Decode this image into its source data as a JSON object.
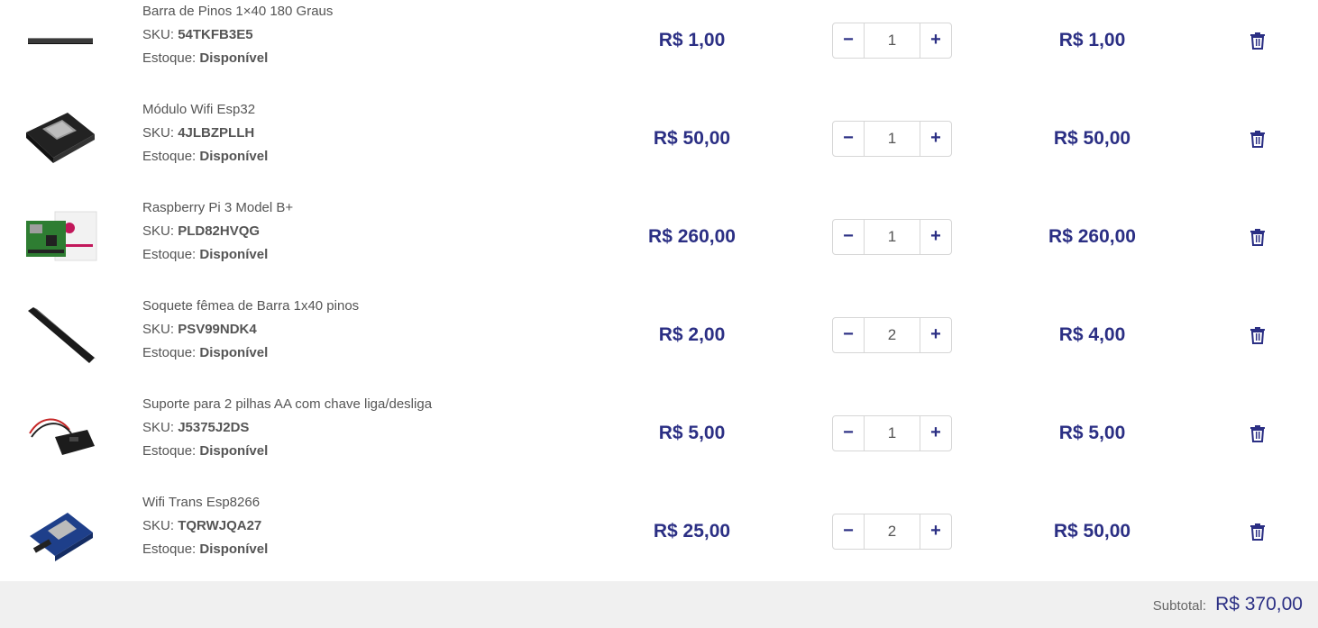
{
  "currency_prefix": "R$",
  "labels": {
    "sku": "SKU:",
    "stock": "Estoque:",
    "subtotal": "Subtotal:"
  },
  "items": [
    {
      "name": "Barra de Pinos 1×40 180 Graus",
      "sku": "54TKFB3E5",
      "stock": "Disponível",
      "price": "R$ 1,00",
      "quantity": "1",
      "total": "R$ 1,00",
      "decrease": "−",
      "increase": "+"
    },
    {
      "name": "Módulo Wifi Esp32",
      "sku": "4JLBZPLLH",
      "stock": "Disponível",
      "price": "R$ 50,00",
      "quantity": "1",
      "total": "R$ 50,00",
      "decrease": "−",
      "increase": "+"
    },
    {
      "name": "Raspberry Pi 3 Model B+",
      "sku": "PLD82HVQG",
      "stock": "Disponível",
      "price": "R$ 260,00",
      "quantity": "1",
      "total": "R$ 260,00",
      "decrease": "−",
      "increase": "+"
    },
    {
      "name": "Soquete fêmea de Barra 1x40 pinos",
      "sku": "PSV99NDK4",
      "stock": "Disponível",
      "price": "R$ 2,00",
      "quantity": "2",
      "total": "R$ 4,00",
      "decrease": "−",
      "increase": "+"
    },
    {
      "name": "Suporte para 2 pilhas AA com chave liga/desliga",
      "sku": "J5375J2DS",
      "stock": "Disponível",
      "price": "R$ 5,00",
      "quantity": "1",
      "total": "R$ 5,00",
      "decrease": "−",
      "increase": "+"
    },
    {
      "name": "Wifi Trans Esp8266",
      "sku": "TQRWJQA27",
      "stock": "Disponível",
      "price": "R$ 25,00",
      "quantity": "2",
      "total": "R$ 50,00",
      "decrease": "−",
      "increase": "+"
    }
  ],
  "subtotal": "R$ 370,00",
  "colors": {
    "accent": "#2b2f84",
    "footer_bg": "#f0f0f0",
    "text": "#555555"
  },
  "icons": {
    "delete": "trash-icon"
  }
}
